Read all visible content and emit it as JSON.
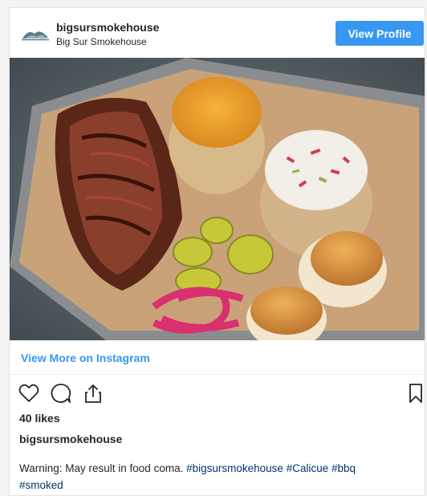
{
  "header": {
    "username": "bigsursmokehouse",
    "fullname": "Big Sur Smokehouse",
    "view_profile_label": "View Profile"
  },
  "photo": {
    "alt": "BBQ tray with brisket, mac and cheese, coleslaw, pickles, pickled onions and rolls"
  },
  "links": {
    "view_on_instagram": "View More on Instagram"
  },
  "actions": {
    "icons": [
      "heart-icon",
      "comment-icon",
      "share-icon",
      "bookmark-icon"
    ]
  },
  "stats": {
    "likes": "40 likes"
  },
  "caption": {
    "username": "bigsursmokehouse",
    "text": "Warning: May result in food coma. ",
    "hashtags": [
      "#bigsursmokehouse",
      "#Calicue",
      "#bbq",
      "#smoked"
    ]
  },
  "colors": {
    "accent": "#3897f0",
    "hashtag": "#003569",
    "text": "#262626"
  }
}
